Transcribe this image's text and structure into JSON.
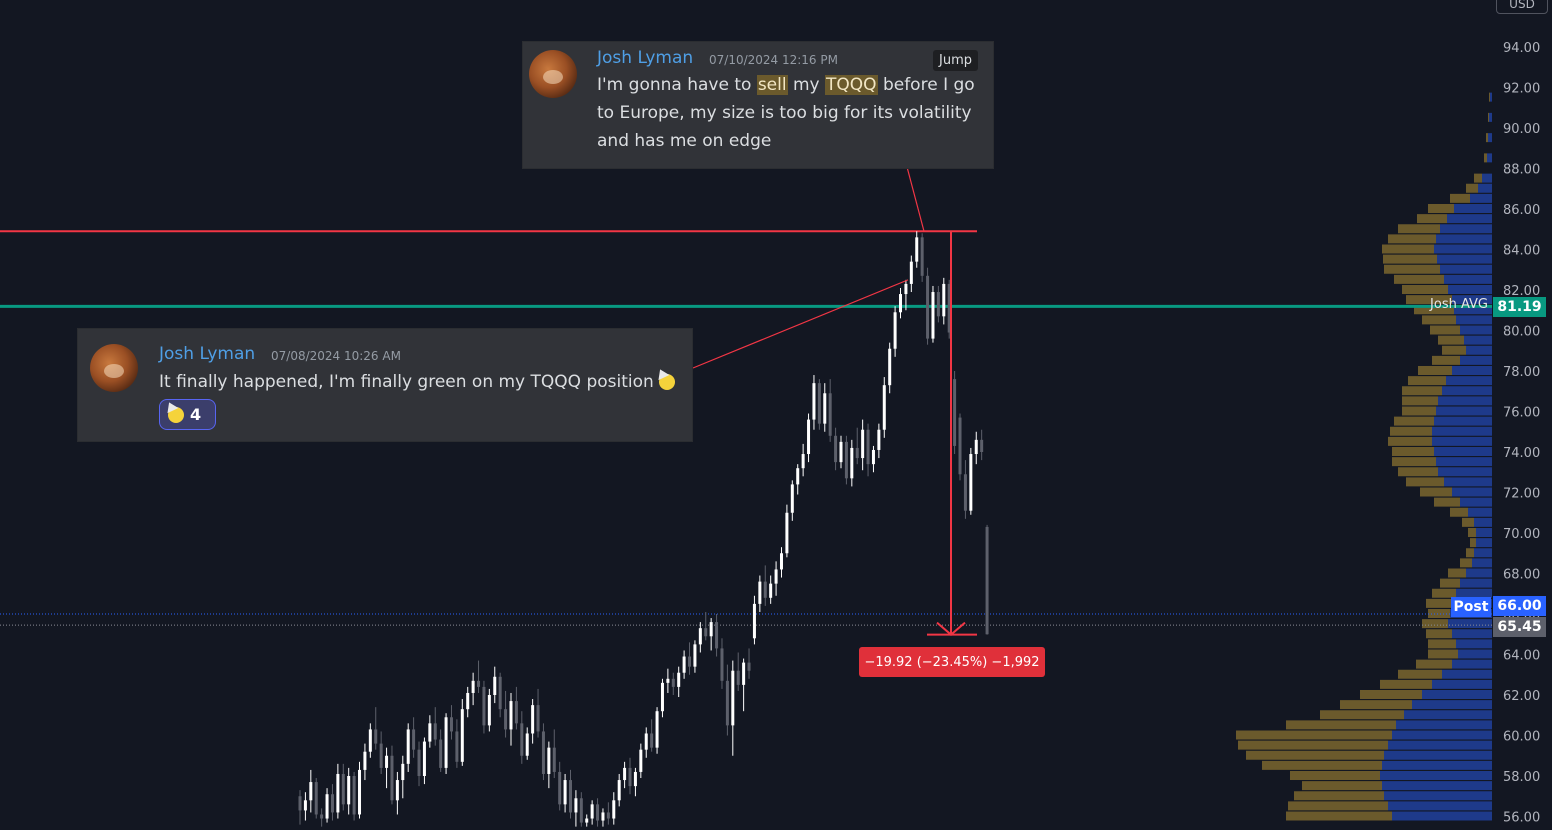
{
  "currency_button": "USD",
  "messages": [
    {
      "author": "Josh Lyman",
      "timestamp": "07/10/2024 12:16 PM",
      "jump_label": "Jump",
      "line1": [
        "I'm gonna have to ",
        "sell",
        " my ",
        "TQQQ",
        " before I go"
      ],
      "line2": "to Europe, my size is too big for its volatility",
      "line3": "and has me on edge"
    },
    {
      "author": "Josh Lyman",
      "timestamp": "07/08/2024 10:26 AM",
      "text": "It finally happened, I'm finally green on my TQQQ position",
      "reaction_count": "4"
    }
  ],
  "annotations": {
    "josh_avg_label": "Josh AVG",
    "josh_avg_value": "81.19",
    "post_label": "Post",
    "post_value": "66.00",
    "last_value": "65.45",
    "measure_label": "−19.92 (−23.45%) −1,992"
  },
  "colors": {
    "background": "#131722",
    "candle_up": "#ffffff",
    "candle_down": "#5d606b",
    "resistance_line": "#f23645",
    "avg_line": "#089981",
    "volume_profile_up": "#1e3a8a",
    "volume_profile_down": "#6b5a2c",
    "post_tag": "#2962ff"
  },
  "chart_data": {
    "type": "candlestick",
    "y_axis_ticks": [
      "94.00",
      "92.00",
      "90.00",
      "88.00",
      "86.00",
      "84.00",
      "82.00",
      "80.00",
      "78.00",
      "76.00",
      "74.00",
      "72.00",
      "70.00",
      "68.00",
      "66.00",
      "64.00",
      "62.00",
      "60.00",
      "58.00",
      "56.00"
    ],
    "ylim": [
      55.5,
      94.9
    ],
    "horizontal_levels": [
      {
        "name": "resistance",
        "value": 84.9
      },
      {
        "name": "Josh AVG",
        "value": 81.19
      }
    ],
    "measure": {
      "from": 84.9,
      "to": 64.98,
      "change": -19.92,
      "percent": -23.45,
      "bars": -1992
    },
    "candles": [
      [
        57.0,
        57.3,
        55.6,
        56.3
      ],
      [
        56.3,
        57.2,
        55.8,
        56.8
      ],
      [
        56.8,
        58.3,
        56.2,
        57.7
      ],
      [
        57.7,
        57.9,
        55.9,
        56.1
      ],
      [
        56.1,
        56.4,
        55.5,
        55.9
      ],
      [
        55.9,
        57.4,
        55.7,
        57.1
      ],
      [
        57.1,
        57.6,
        55.8,
        56.2
      ],
      [
        56.2,
        58.6,
        55.9,
        58.1
      ],
      [
        58.1,
        58.6,
        56.3,
        56.6
      ],
      [
        56.6,
        58.4,
        56.1,
        58.0
      ],
      [
        58.0,
        58.2,
        55.8,
        56.1
      ],
      [
        56.1,
        58.7,
        55.9,
        58.3
      ],
      [
        58.3,
        59.6,
        57.8,
        59.2
      ],
      [
        59.2,
        60.6,
        58.9,
        60.3
      ],
      [
        60.3,
        61.4,
        59.3,
        59.6
      ],
      [
        59.6,
        60.2,
        58.1,
        58.4
      ],
      [
        58.4,
        59.4,
        57.4,
        59.0
      ],
      [
        59.0,
        59.5,
        56.6,
        56.8
      ],
      [
        56.8,
        58.2,
        56.1,
        57.8
      ],
      [
        57.8,
        59.0,
        56.9,
        58.6
      ],
      [
        58.6,
        60.6,
        58.2,
        60.3
      ],
      [
        60.3,
        60.9,
        58.9,
        59.3
      ],
      [
        59.3,
        59.7,
        57.5,
        58.0
      ],
      [
        58.0,
        59.9,
        57.6,
        59.7
      ],
      [
        59.7,
        61.0,
        59.4,
        60.6
      ],
      [
        60.6,
        61.4,
        59.5,
        59.8
      ],
      [
        59.8,
        60.3,
        58.2,
        58.4
      ],
      [
        58.4,
        61.1,
        58.1,
        60.9
      ],
      [
        60.9,
        61.5,
        59.8,
        60.2
      ],
      [
        60.2,
        60.8,
        58.4,
        58.7
      ],
      [
        58.7,
        61.8,
        58.5,
        61.3
      ],
      [
        61.3,
        62.4,
        60.9,
        62.1
      ],
      [
        62.1,
        63.1,
        61.5,
        62.7
      ],
      [
        62.7,
        63.7,
        62.1,
        62.4
      ],
      [
        62.4,
        62.7,
        60.1,
        60.5
      ],
      [
        60.5,
        62.3,
        60.2,
        62.0
      ],
      [
        62.0,
        63.4,
        61.6,
        62.9
      ],
      [
        62.9,
        63.1,
        60.9,
        61.3
      ],
      [
        61.3,
        62.2,
        59.9,
        60.3
      ],
      [
        60.3,
        62.1,
        59.5,
        61.7
      ],
      [
        61.7,
        62.4,
        60.3,
        60.6
      ],
      [
        60.6,
        61.2,
        58.6,
        59.0
      ],
      [
        59.0,
        60.4,
        58.8,
        60.1
      ],
      [
        60.1,
        61.8,
        59.6,
        61.5
      ],
      [
        61.5,
        62.3,
        59.9,
        60.2
      ],
      [
        60.2,
        60.6,
        57.8,
        58.1
      ],
      [
        58.1,
        59.7,
        57.4,
        59.4
      ],
      [
        59.4,
        60.3,
        57.9,
        58.2
      ],
      [
        58.2,
        58.7,
        56.3,
        56.6
      ],
      [
        56.6,
        58.1,
        56.2,
        57.8
      ],
      [
        57.8,
        58.3,
        55.9,
        56.2
      ],
      [
        56.2,
        57.3,
        55.5,
        56.9
      ],
      [
        56.9,
        57.2,
        55.5,
        55.7
      ],
      [
        55.7,
        56.1,
        55.5,
        55.9
      ],
      [
        55.9,
        56.8,
        55.6,
        56.6
      ],
      [
        56.6,
        56.9,
        55.5,
        55.8
      ],
      [
        55.8,
        56.4,
        55.5,
        56.2
      ],
      [
        56.2,
        56.7,
        55.6,
        55.9
      ],
      [
        55.9,
        57.2,
        55.6,
        56.8
      ],
      [
        56.8,
        58.1,
        56.5,
        57.8
      ],
      [
        57.8,
        58.7,
        57.4,
        58.4
      ],
      [
        58.4,
        58.9,
        57.1,
        57.5
      ],
      [
        57.5,
        58.4,
        57.0,
        58.2
      ],
      [
        58.2,
        59.6,
        57.9,
        59.3
      ],
      [
        59.3,
        60.4,
        58.9,
        60.1
      ],
      [
        60.1,
        60.8,
        59.2,
        59.4
      ],
      [
        59.4,
        61.4,
        59.1,
        61.2
      ],
      [
        61.2,
        62.8,
        60.9,
        62.6
      ],
      [
        62.6,
        63.3,
        62.1,
        62.8
      ],
      [
        62.8,
        63.1,
        62.0,
        62.4
      ],
      [
        62.4,
        63.4,
        61.9,
        63.1
      ],
      [
        63.1,
        64.2,
        62.8,
        63.9
      ],
      [
        63.9,
        64.6,
        63.0,
        63.4
      ],
      [
        63.4,
        64.7,
        63.1,
        64.5
      ],
      [
        64.5,
        65.6,
        64.1,
        65.3
      ],
      [
        65.3,
        66.1,
        64.7,
        64.9
      ],
      [
        64.9,
        65.8,
        64.2,
        65.6
      ],
      [
        65.6,
        66.0,
        63.9,
        64.3
      ],
      [
        64.3,
        64.8,
        62.3,
        62.7
      ],
      [
        62.7,
        63.5,
        60.0,
        60.5
      ],
      [
        60.5,
        63.7,
        59.0,
        63.2
      ],
      [
        63.2,
        64.1,
        62.2,
        62.5
      ],
      [
        62.5,
        63.8,
        61.2,
        63.6
      ],
      [
        63.6,
        64.3,
        62.8,
        63.2
      ],
      [
        64.8,
        66.9,
        64.5,
        66.5
      ],
      [
        66.5,
        67.9,
        66.1,
        67.6
      ],
      [
        67.6,
        68.4,
        66.4,
        66.8
      ],
      [
        66.8,
        67.9,
        66.5,
        67.5
      ],
      [
        67.5,
        68.6,
        66.9,
        68.2
      ],
      [
        68.2,
        69.3,
        67.8,
        69.0
      ],
      [
        69.0,
        71.4,
        68.8,
        71.0
      ],
      [
        71.0,
        72.6,
        70.6,
        72.4
      ],
      [
        72.4,
        73.4,
        71.9,
        73.2
      ],
      [
        73.2,
        74.4,
        72.8,
        73.9
      ],
      [
        73.9,
        75.9,
        73.5,
        75.6
      ],
      [
        75.6,
        77.8,
        75.1,
        77.4
      ],
      [
        77.4,
        77.6,
        75.1,
        75.4
      ],
      [
        75.4,
        77.4,
        75.0,
        76.9
      ],
      [
        76.9,
        77.6,
        74.5,
        74.8
      ],
      [
        74.8,
        75.2,
        73.1,
        73.5
      ],
      [
        73.5,
        74.8,
        73.2,
        74.5
      ],
      [
        74.5,
        74.8,
        72.4,
        72.7
      ],
      [
        72.7,
        74.6,
        72.3,
        74.2
      ],
      [
        74.2,
        75.2,
        73.4,
        73.7
      ],
      [
        73.7,
        75.6,
        73.1,
        75.1
      ],
      [
        75.1,
        75.4,
        72.8,
        73.4
      ],
      [
        73.4,
        74.3,
        73.0,
        74.1
      ],
      [
        74.1,
        75.4,
        73.7,
        75.1
      ],
      [
        75.1,
        77.7,
        74.7,
        77.3
      ],
      [
        77.3,
        79.4,
        76.9,
        79.1
      ],
      [
        79.1,
        81.2,
        78.7,
        80.9
      ],
      [
        80.9,
        82.1,
        80.6,
        81.8
      ],
      [
        81.8,
        82.5,
        81.0,
        82.3
      ],
      [
        82.3,
        83.7,
        81.9,
        83.4
      ],
      [
        83.4,
        84.9,
        83.1,
        84.6
      ],
      [
        84.6,
        84.8,
        82.4,
        82.7
      ],
      [
        82.7,
        83.1,
        79.3,
        79.6
      ],
      [
        79.6,
        82.2,
        79.4,
        81.9
      ],
      [
        81.9,
        82.2,
        80.4,
        80.7
      ],
      [
        80.7,
        82.6,
        80.3,
        82.3
      ],
      [
        82.3,
        82.5,
        79.6,
        79.9
      ],
      [
        77.6,
        78.0,
        73.9,
        74.3
      ],
      [
        75.7,
        75.9,
        72.6,
        72.9
      ],
      [
        72.9,
        73.6,
        70.7,
        71.1
      ],
      [
        71.1,
        74.2,
        70.9,
        73.9
      ],
      [
        73.9,
        75.0,
        73.4,
        74.6
      ],
      [
        74.6,
        75.1,
        73.6,
        74.0
      ],
      [
        70.3,
        70.4,
        64.98,
        65.0
      ]
    ],
    "volume_profile": [
      {
        "price": 91.5,
        "up": 2,
        "down": 1
      },
      {
        "price": 90.5,
        "up": 3,
        "down": 1
      },
      {
        "price": 89.5,
        "up": 4,
        "down": 2
      },
      {
        "price": 88.5,
        "up": 5,
        "down": 3
      },
      {
        "price": 87.5,
        "up": 10,
        "down": 8
      },
      {
        "price": 87.0,
        "up": 14,
        "down": 12
      },
      {
        "price": 86.5,
        "up": 22,
        "down": 20
      },
      {
        "price": 86.0,
        "up": 38,
        "down": 26
      },
      {
        "price": 85.5,
        "up": 45,
        "down": 30
      },
      {
        "price": 85.0,
        "up": 52,
        "down": 42
      },
      {
        "price": 84.5,
        "up": 56,
        "down": 48
      },
      {
        "price": 84.0,
        "up": 58,
        "down": 52
      },
      {
        "price": 83.5,
        "up": 55,
        "down": 54
      },
      {
        "price": 83.0,
        "up": 52,
        "down": 56
      },
      {
        "price": 82.5,
        "up": 48,
        "down": 50
      },
      {
        "price": 82.0,
        "up": 44,
        "down": 46
      },
      {
        "price": 81.5,
        "up": 40,
        "down": 46
      },
      {
        "price": 81.0,
        "up": 38,
        "down": 40
      },
      {
        "price": 80.5,
        "up": 36,
        "down": 34
      },
      {
        "price": 80.0,
        "up": 32,
        "down": 30
      },
      {
        "price": 79.5,
        "up": 28,
        "down": 26
      },
      {
        "price": 79.0,
        "up": 26,
        "down": 24
      },
      {
        "price": 78.5,
        "up": 32,
        "down": 28
      },
      {
        "price": 78.0,
        "up": 40,
        "down": 34
      },
      {
        "price": 77.5,
        "up": 46,
        "down": 38
      },
      {
        "price": 77.0,
        "up": 50,
        "down": 40
      },
      {
        "price": 76.5,
        "up": 54,
        "down": 36
      },
      {
        "price": 76.0,
        "up": 56,
        "down": 34
      },
      {
        "price": 75.5,
        "up": 58,
        "down": 40
      },
      {
        "price": 75.0,
        "up": 60,
        "down": 42
      },
      {
        "price": 74.5,
        "up": 60,
        "down": 44
      },
      {
        "price": 74.0,
        "up": 58,
        "down": 42
      },
      {
        "price": 73.5,
        "up": 56,
        "down": 44
      },
      {
        "price": 73.0,
        "up": 54,
        "down": 40
      },
      {
        "price": 72.5,
        "up": 48,
        "down": 38
      },
      {
        "price": 72.0,
        "up": 40,
        "down": 32
      },
      {
        "price": 71.5,
        "up": 32,
        "down": 26
      },
      {
        "price": 71.0,
        "up": 24,
        "down": 18
      },
      {
        "price": 70.5,
        "up": 18,
        "down": 12
      },
      {
        "price": 70.0,
        "up": 16,
        "down": 8
      },
      {
        "price": 69.5,
        "up": 16,
        "down": 6
      },
      {
        "price": 69.0,
        "up": 18,
        "down": 8
      },
      {
        "price": 68.5,
        "up": 20,
        "down": 12
      },
      {
        "price": 68.0,
        "up": 26,
        "down": 18
      },
      {
        "price": 67.5,
        "up": 32,
        "down": 20
      },
      {
        "price": 67.0,
        "up": 36,
        "down": 24
      },
      {
        "price": 66.5,
        "up": 40,
        "down": 26
      },
      {
        "price": 66.0,
        "up": 42,
        "down": 22
      },
      {
        "price": 65.5,
        "up": 44,
        "down": 26
      },
      {
        "price": 65.0,
        "up": 40,
        "down": 26
      },
      {
        "price": 64.5,
        "up": 36,
        "down": 28
      },
      {
        "price": 64.0,
        "up": 34,
        "down": 30
      },
      {
        "price": 63.5,
        "up": 40,
        "down": 36
      },
      {
        "price": 63.0,
        "up": 50,
        "down": 44
      },
      {
        "price": 62.5,
        "up": 60,
        "down": 52
      },
      {
        "price": 62.0,
        "up": 70,
        "down": 62
      },
      {
        "price": 61.5,
        "up": 80,
        "down": 72
      },
      {
        "price": 61.0,
        "up": 88,
        "down": 84
      },
      {
        "price": 60.5,
        "up": 96,
        "down": 110
      },
      {
        "price": 60.0,
        "up": 100,
        "down": 156
      },
      {
        "price": 59.5,
        "up": 104,
        "down": 150
      },
      {
        "price": 59.0,
        "up": 108,
        "down": 138
      },
      {
        "price": 58.5,
        "up": 110,
        "down": 120
      },
      {
        "price": 58.0,
        "up": 112,
        "down": 90
      },
      {
        "price": 57.5,
        "up": 110,
        "down": 80
      },
      {
        "price": 57.0,
        "up": 108,
        "down": 90
      },
      {
        "price": 56.5,
        "up": 104,
        "down": 100
      },
      {
        "price": 56.0,
        "up": 100,
        "down": 106
      }
    ]
  }
}
